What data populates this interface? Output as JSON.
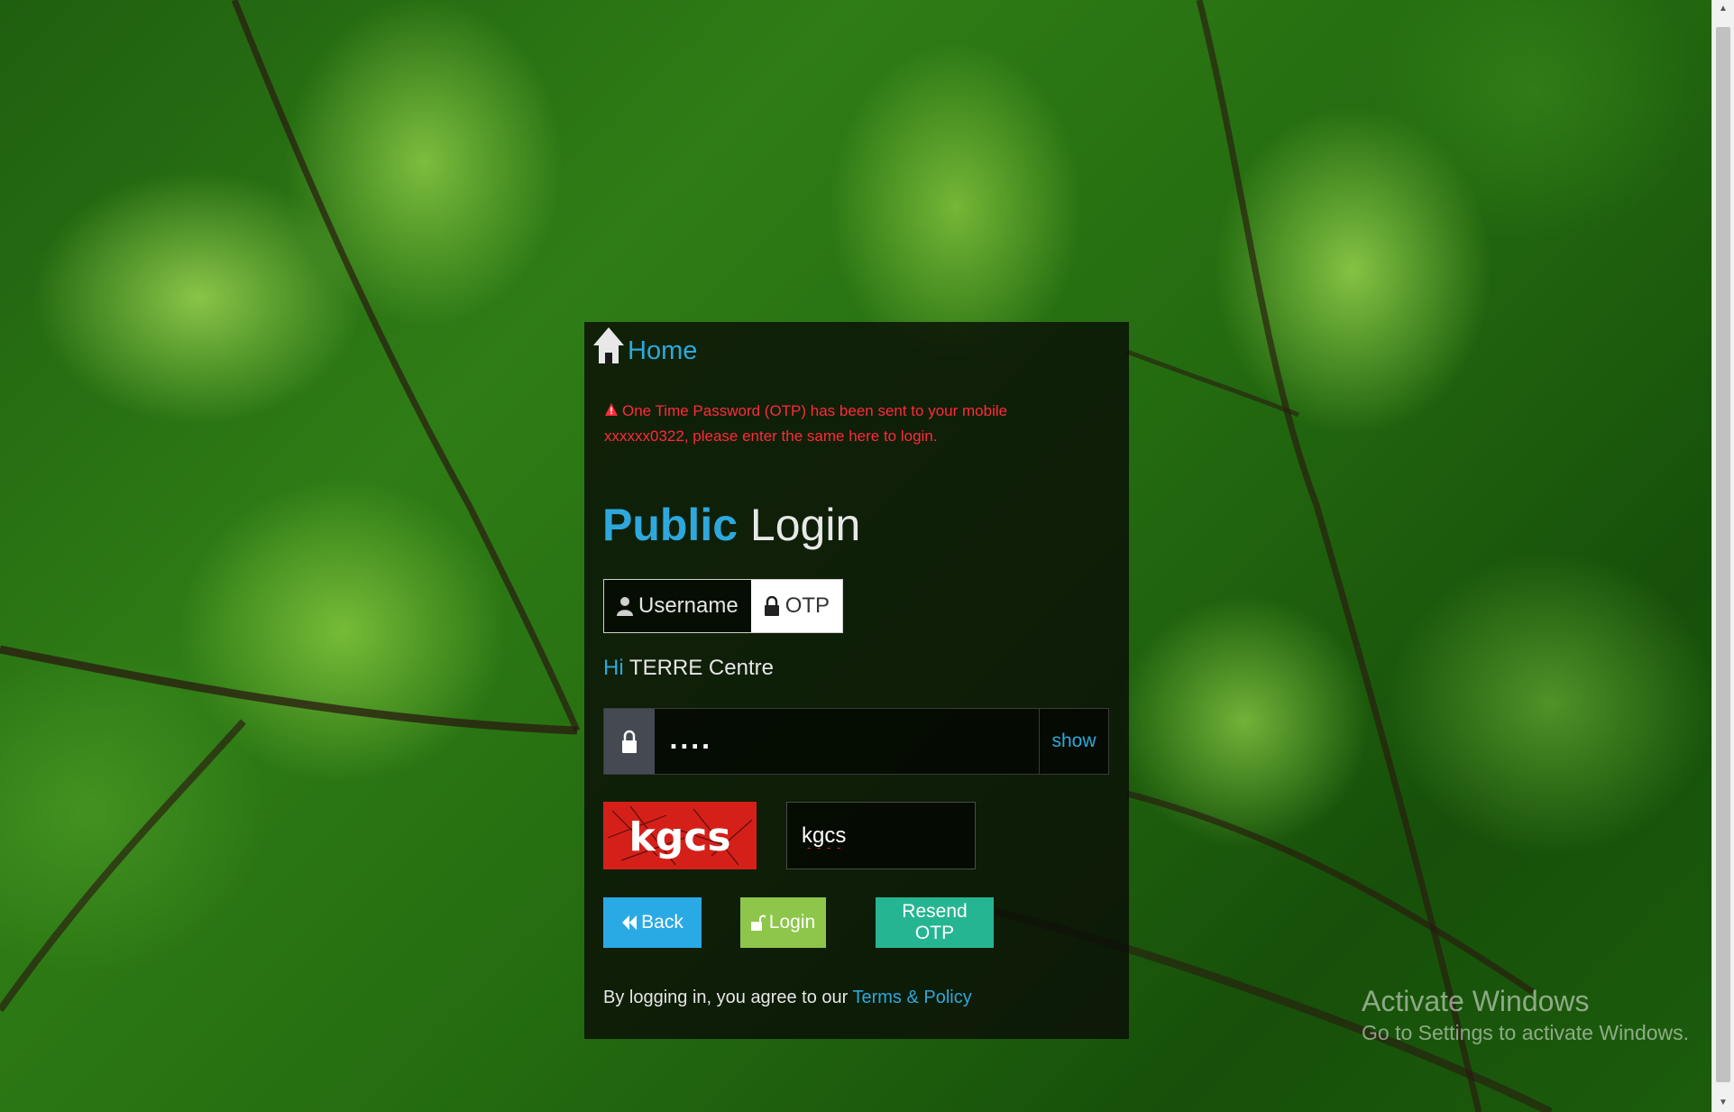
{
  "home": {
    "label": "Home"
  },
  "alert": {
    "message": "One Time Password (OTP) has been sent to your mobile xxxxxx0322, please enter the same here to login."
  },
  "title": {
    "bold": "Public",
    "rest": " Login"
  },
  "tabs": [
    {
      "label": "Username",
      "icon": "user-icon",
      "active": false
    },
    {
      "label": "OTP",
      "icon": "lock-icon",
      "active": true
    }
  ],
  "greeting": {
    "hi": "Hi",
    "name": " TERRE Centre"
  },
  "otp_field": {
    "value": "....",
    "show_label": "show"
  },
  "captcha": {
    "image_text": "kgcs",
    "input_value": "kgcs"
  },
  "buttons": {
    "back": "Back",
    "login": "Login",
    "resend": "Resend OTP"
  },
  "terms": {
    "prefix": "By logging in, you agree to our ",
    "link": "Terms & Policy"
  },
  "watermark": {
    "title": "Activate Windows",
    "subtitle": "Go to Settings to activate Windows."
  },
  "colors": {
    "accent": "#2ea8dc",
    "alert": "#ff2a3a",
    "back_button": "#2aaae4",
    "login_button": "#8dc64a",
    "resend_button": "#26b592",
    "captcha_bg": "#d5201a"
  }
}
